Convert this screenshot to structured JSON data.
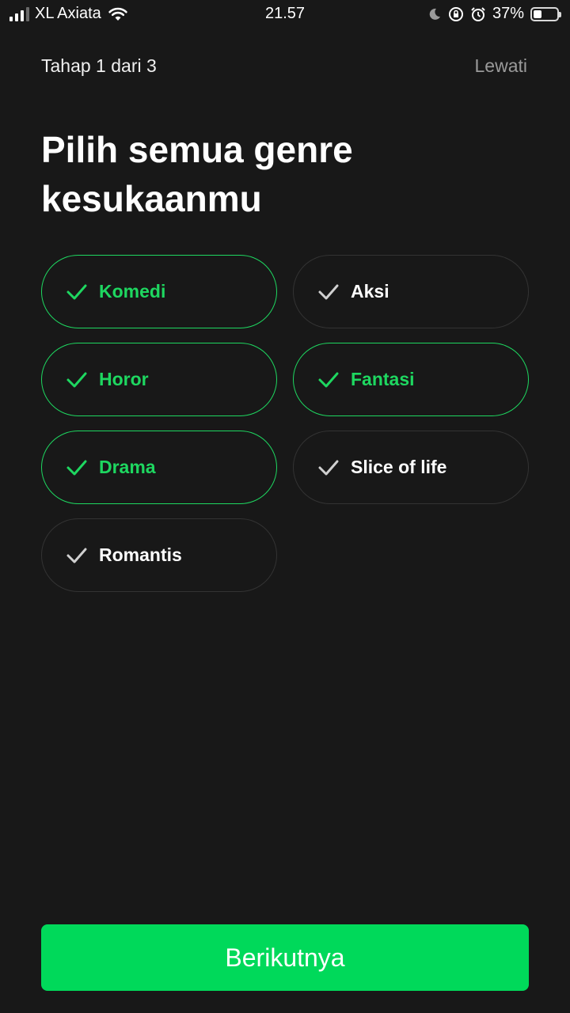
{
  "status_bar": {
    "carrier": "XL Axiata",
    "time": "21.57",
    "battery_percent_text": "37%",
    "battery_level": 0.37,
    "signal_bars_active": 3,
    "signal_bars_total": 4
  },
  "header": {
    "step": "Tahap 1 dari 3",
    "skip_label": "Lewati"
  },
  "title": "Pilih semua genre kesukaanmu",
  "genres": [
    {
      "label": "Komedi",
      "selected": true
    },
    {
      "label": "Aksi",
      "selected": false
    },
    {
      "label": "Horor",
      "selected": true
    },
    {
      "label": "Fantasi",
      "selected": true
    },
    {
      "label": "Drama",
      "selected": true
    },
    {
      "label": "Slice of life",
      "selected": false
    },
    {
      "label": "Romantis",
      "selected": false
    }
  ],
  "next_button_label": "Berikutnya",
  "colors": {
    "background": "#181818",
    "accent": "#1ed760",
    "button": "#00d95a",
    "unselected_check": "#d0d0d0",
    "chip_border": "#333333"
  }
}
